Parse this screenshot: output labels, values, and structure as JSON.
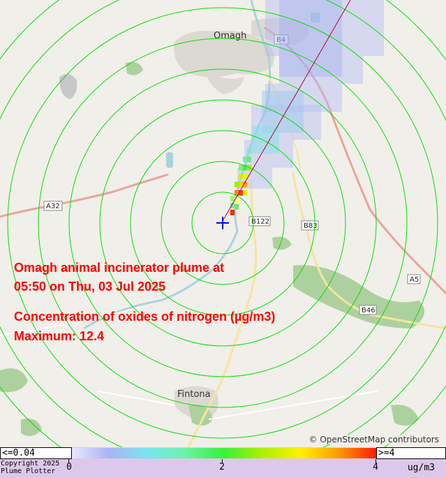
{
  "title": {
    "line1": "Omagh animal incinerator plume at",
    "line2": "05:50 on Thu, 03 Jul 2025",
    "pollutant": "Concentration of oxides of nitrogen (µg/m3)",
    "maximum": "Maximum: 12.4"
  },
  "map": {
    "attribution": "© OpenStreetMap contributors",
    "towns": [
      "Omagh",
      "Fintona"
    ],
    "roads": [
      "B4",
      "A32",
      "B122",
      "B83",
      "A5",
      "B46"
    ],
    "colors": {
      "rings": "#00e000",
      "source_marker": "#0000ff",
      "wind_line": "#b00030"
    }
  },
  "legend": {
    "low_label": "<=0.04",
    "high_label": ">=4",
    "ticks": [
      "0",
      "2",
      "4"
    ],
    "units": "ug/m3",
    "copyright_line1": "Copyright 2025",
    "copyright_line2": "Plume Plotter"
  }
}
